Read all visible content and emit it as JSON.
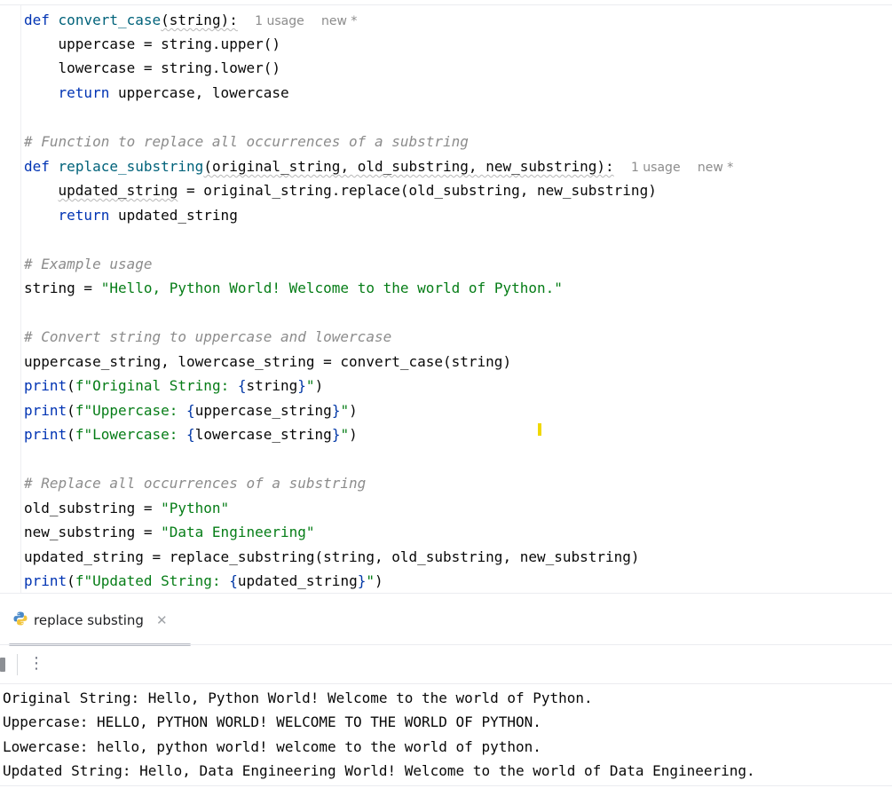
{
  "editor": {
    "hints": {
      "usage": "1 usage",
      "new": "new *"
    },
    "lines": {
      "l1": {
        "kw": "def",
        "fn": "convert_case",
        "params": "(string):"
      },
      "l2": "    uppercase = string.upper()",
      "l3": "    lowercase = string.lower()",
      "l4": {
        "indent": "    ",
        "kw": "return",
        "rest": " uppercase, lowercase"
      },
      "l6": "# Function to replace all occurrences of a substring",
      "l7": {
        "kw": "def",
        "fn": "replace_substring",
        "params": "(original_string, old_substring, new_substring):"
      },
      "l8": {
        "indent": "    ",
        "var": "updated_string",
        "rest": " = original_string.replace(old_substring, new_substring)"
      },
      "l9": {
        "indent": "    ",
        "kw": "return",
        "rest": " updated_string"
      },
      "l11": "# Example usage",
      "l12": {
        "pre": "string = ",
        "str": "\"Hello, Python World! Welcome to the world of Python.\""
      },
      "l14": "# Convert string to uppercase and lowercase",
      "l15": "uppercase_string, lowercase_string = convert_case(string)",
      "l16": {
        "kw": "print",
        "open": "(",
        "str1": "f\"Original String: ",
        "b1": "{",
        "var": "string",
        "b2": "}",
        "str2": "\"",
        "close": ")"
      },
      "l17": {
        "kw": "print",
        "open": "(",
        "str1": "f\"Uppercase: ",
        "b1": "{",
        "var": "uppercase_string",
        "b2": "}",
        "str2": "\"",
        "close": ")"
      },
      "l18": {
        "kw": "print",
        "open": "(",
        "str1": "f\"Lowercase: ",
        "b1": "{",
        "var": "lowercase_string",
        "b2": "}",
        "str2": "\"",
        "close": ")"
      },
      "l20": "# Replace all occurrences of a substring",
      "l21": {
        "pre": "old_substring = ",
        "str": "\"Python\""
      },
      "l22": {
        "pre": "new_substring = ",
        "str": "\"Data Engineering\""
      },
      "l23": "updated_string = replace_substring(string, old_substring, new_substring)",
      "l24": {
        "kw": "print",
        "open": "(",
        "str1": "f\"Updated String: ",
        "b1": "{",
        "var": "updated_string",
        "b2": "}",
        "str2": "\"",
        "close": ")"
      }
    }
  },
  "run": {
    "tab_label": "replace substing",
    "tab_icon": "python-icon",
    "output": [
      "Original String: Hello, Python World! Welcome to the world of Python.",
      "Uppercase: HELLO, PYTHON WORLD! WELCOME TO THE WORLD OF PYTHON.",
      "Lowercase: hello, python world! welcome to the world of python.",
      "Updated String: Hello, Data Engineering World! Welcome to the world of Data Engineering."
    ]
  },
  "colors": {
    "keyword": "#0033b3",
    "function": "#00627a",
    "string": "#067d17",
    "comment": "#8c8c8c",
    "caret": "#f0d800"
  }
}
